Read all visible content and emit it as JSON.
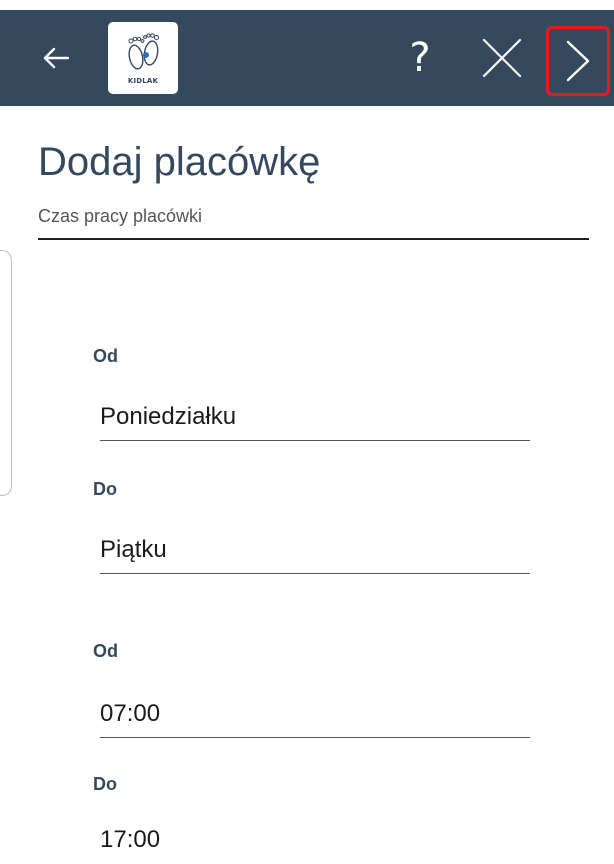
{
  "header": {
    "logo_text": "KIDLAK",
    "help_label": "?",
    "icons": [
      "back-arrow-icon",
      "kidlak-logo",
      "help-icon",
      "close-icon",
      "next-chevron-icon"
    ],
    "colors": {
      "bar": "#34495e",
      "icon": "#ffffff",
      "next_highlight": "#e11b22"
    }
  },
  "page": {
    "title": "Dodaj placówkę",
    "section_label": "Czas pracy placówki",
    "accent_color": "#34495e"
  },
  "form": {
    "day_from_label": "Od",
    "day_from_value": "Poniedziałku",
    "day_to_label": "Do",
    "day_to_value": "Piątku",
    "time_from_label": "Od",
    "time_from_value": "07:00",
    "time_to_label": "Do",
    "time_to_value": "17:00"
  }
}
